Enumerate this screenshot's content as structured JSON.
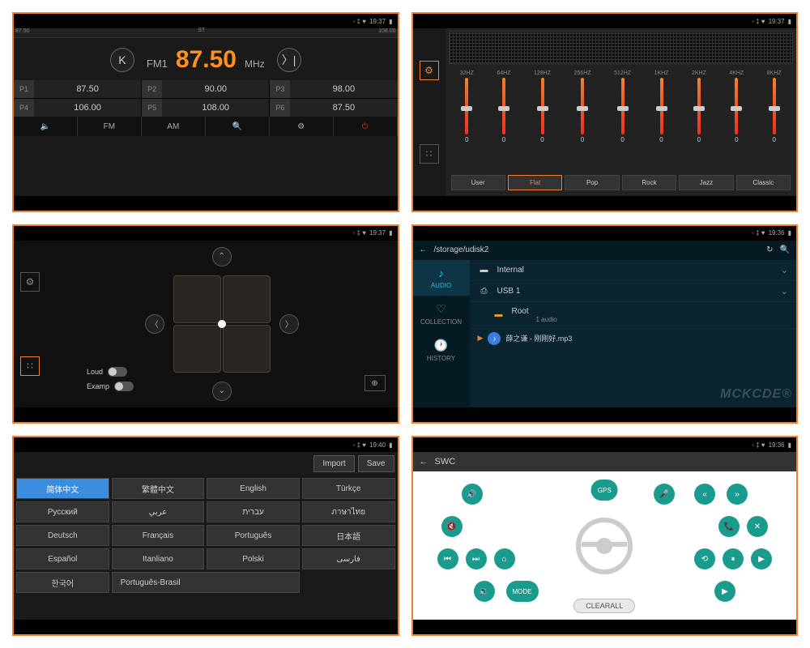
{
  "status": {
    "time1": "19:37",
    "time2": "19:37",
    "time3": "19:37",
    "time4": "19:36",
    "time5": "19:40",
    "time6": "19:36"
  },
  "radio": {
    "st": "ST",
    "band": "FM1",
    "freq": "87.50",
    "unit": "MHz",
    "scale_min": "87.50",
    "scale_max": "108.00",
    "presets": [
      {
        "label": "P1",
        "val": "87.50"
      },
      {
        "label": "P2",
        "val": "90.00"
      },
      {
        "label": "P3",
        "val": "98.00"
      },
      {
        "label": "P4",
        "val": "106.00"
      },
      {
        "label": "P5",
        "val": "108.00"
      },
      {
        "label": "P6",
        "val": "87.50"
      }
    ],
    "bottom": {
      "fm": "FM",
      "am": "AM"
    }
  },
  "eq": {
    "bands": [
      {
        "f": "32HZ",
        "v": "0"
      },
      {
        "f": "64HZ",
        "v": "0"
      },
      {
        "f": "128HZ",
        "v": "0"
      },
      {
        "f": "256HZ",
        "v": "0"
      },
      {
        "f": "512HZ",
        "v": "0"
      },
      {
        "f": "1KHZ",
        "v": "0"
      },
      {
        "f": "2KHZ",
        "v": "0"
      },
      {
        "f": "4KHZ",
        "v": "0"
      },
      {
        "f": "8KHZ",
        "v": "0"
      }
    ],
    "presets": [
      "User",
      "Flat",
      "Pop",
      "Rock",
      "Jazz",
      "Classic"
    ],
    "active_preset": "Flat"
  },
  "balance": {
    "loud": "Loud",
    "examp": "Examp"
  },
  "files": {
    "path": "/storage/udisk2",
    "tabs": {
      "audio": "AUDIO",
      "collection": "COLLECTION",
      "history": "HISTORY"
    },
    "items": {
      "internal": "Internal",
      "usb": "USB 1",
      "root": "Root",
      "root_sub": "1 audio"
    },
    "playing": "薛之谦 - 刚刚好.mp3",
    "watermark": "MCKCDE®"
  },
  "lang": {
    "import": "Import",
    "save": "Save",
    "items": [
      "简体中文",
      "繁體中文",
      "English",
      "Türkçe",
      "Русский",
      "عربي",
      "עברית",
      "ภาษาไทย",
      "Deutsch",
      "Français",
      "Português",
      "日本語",
      "Español",
      "Itanliano",
      "Polski",
      "فارسی",
      "한국어",
      "Português-Brasil"
    ]
  },
  "swc": {
    "title": "SWC",
    "gps": "GPS",
    "mode": "MODE",
    "clear": "CLEARALL"
  }
}
